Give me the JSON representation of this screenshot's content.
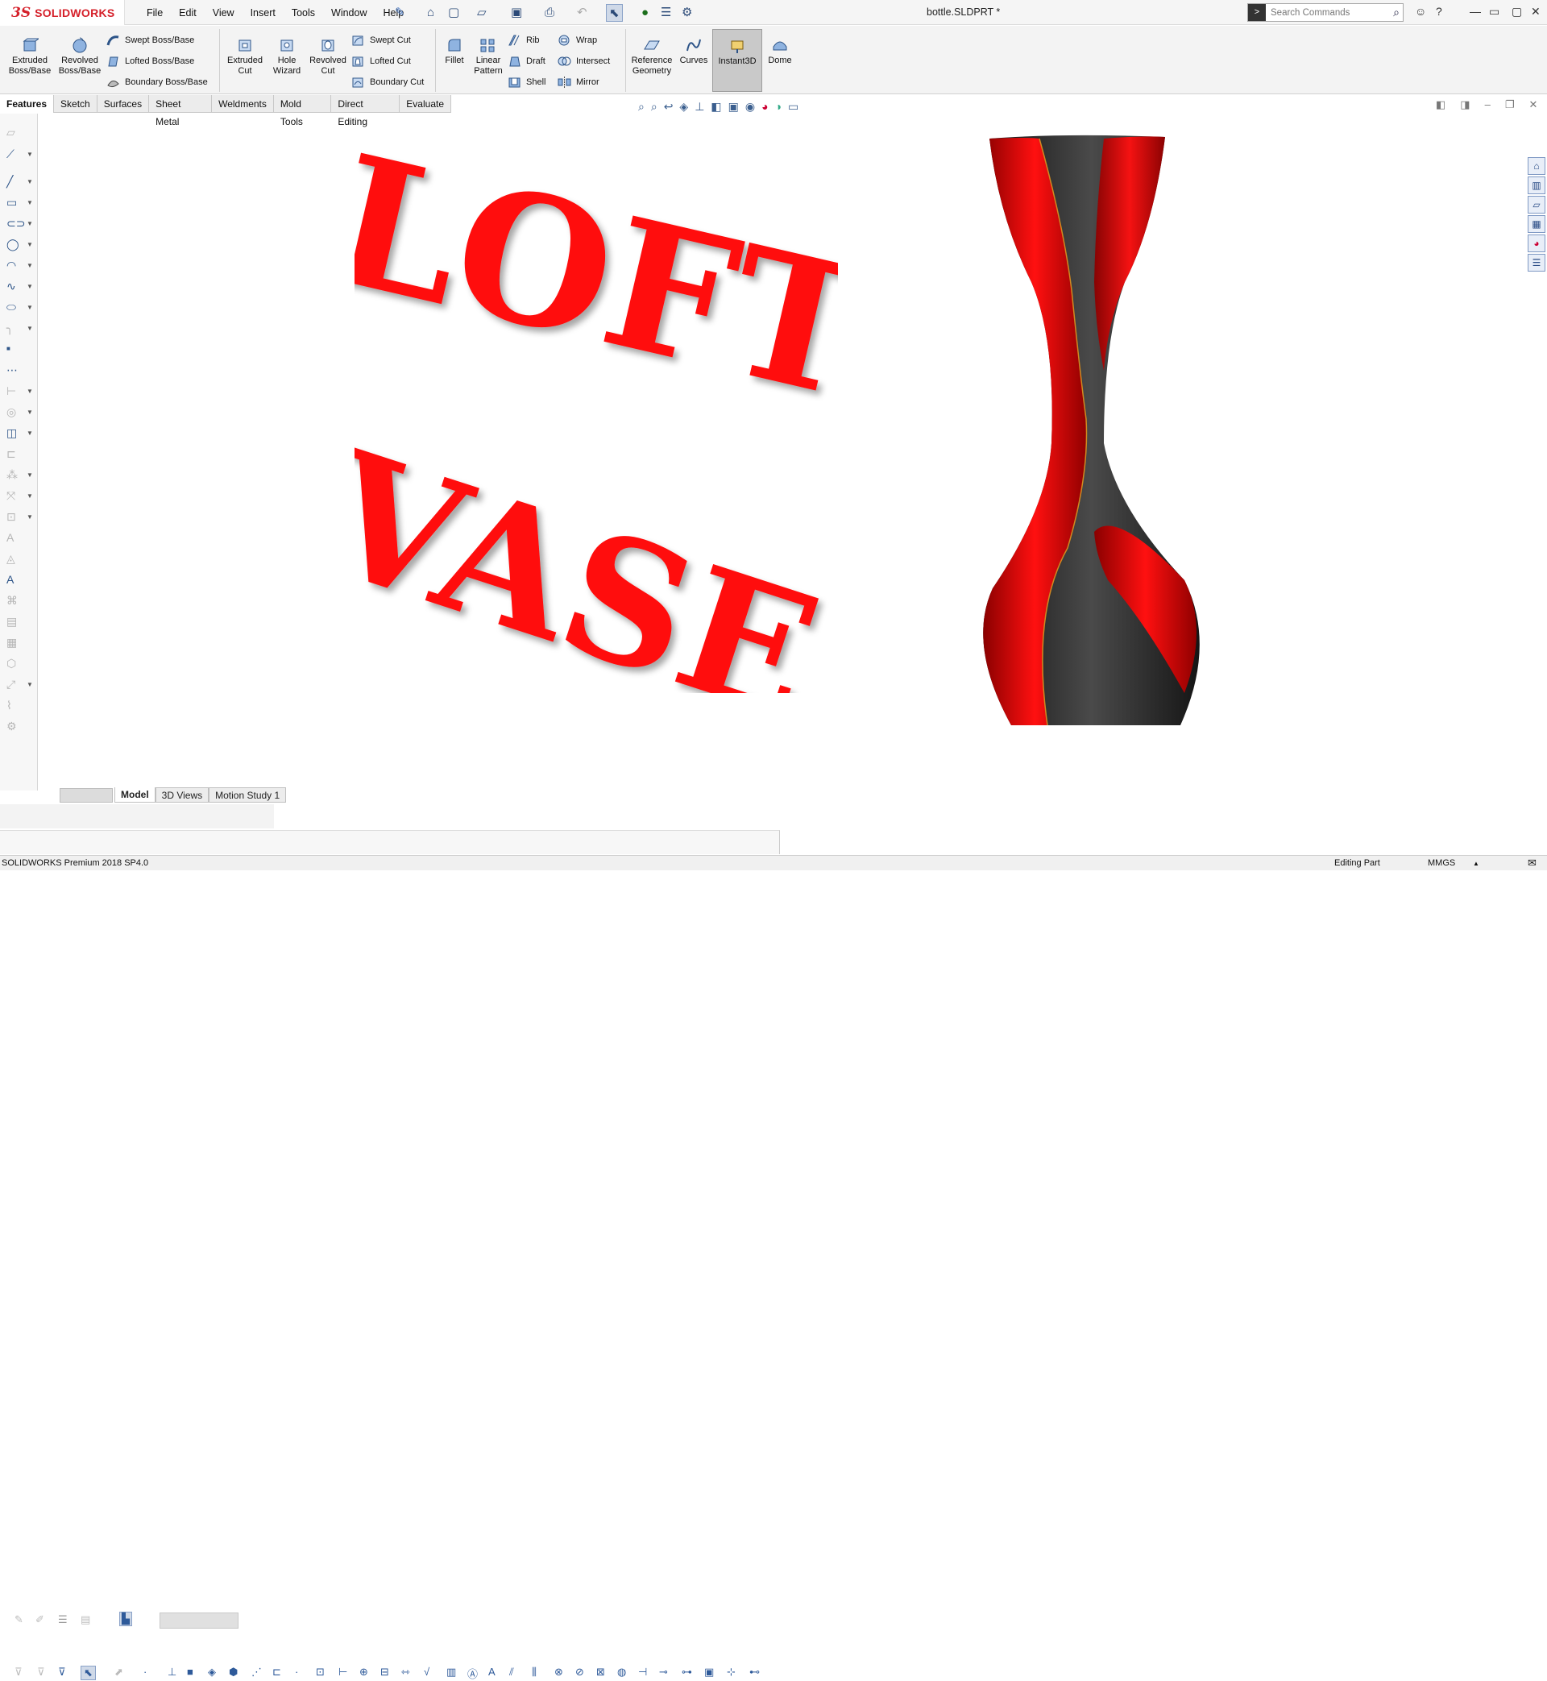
{
  "app": {
    "brand_ds": "3S",
    "brand_name": "SOLIDWORKS",
    "document_title": "bottle.SLDPRT *"
  },
  "menu": [
    "File",
    "Edit",
    "View",
    "Insert",
    "Tools",
    "Window",
    "Help"
  ],
  "search": {
    "placeholder": "Search Commands"
  },
  "commands": {
    "extruded_boss": "Extruded Boss/Base",
    "revolved_boss": "Revolved Boss/Base",
    "swept_boss": "Swept Boss/Base",
    "lofted_boss": "Lofted Boss/Base",
    "boundary_boss": "Boundary Boss/Base",
    "extruded_cut": "Extruded Cut",
    "hole_wizard": "Hole Wizard",
    "revolved_cut": "Revolved Cut",
    "swept_cut": "Swept Cut",
    "lofted_cut": "Lofted Cut",
    "boundary_cut": "Boundary Cut",
    "fillet": "Fillet",
    "linear_pattern": "Linear Pattern",
    "rib": "Rib",
    "draft": "Draft",
    "shell": "Shell",
    "wrap": "Wrap",
    "intersect": "Intersect",
    "mirror": "Mirror",
    "reference_geometry": "Reference Geometry",
    "curves": "Curves",
    "instant3d": "Instant3D",
    "dome": "Dome"
  },
  "tabs": [
    "Features",
    "Sketch",
    "Surfaces",
    "Sheet Metal",
    "Weldments",
    "Mold Tools",
    "Direct Editing",
    "Evaluate"
  ],
  "viewport": {
    "title_line1": "LOFT",
    "title_line2": "VASE",
    "colors": {
      "red": "#ff0a0a",
      "vase_black": "#252525",
      "vase_red": "#e30000"
    }
  },
  "bottom_tabs": [
    "Model",
    "3D Views",
    "Motion Study 1"
  ],
  "status": {
    "product": "SOLIDWORKS Premium 2018 SP4.0",
    "mode": "Editing Part",
    "units": "MMGS"
  }
}
